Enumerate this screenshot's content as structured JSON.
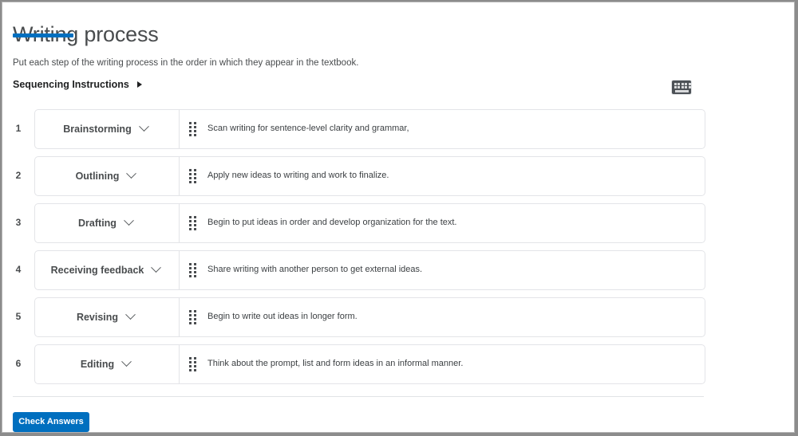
{
  "page": {
    "title": "Writing process",
    "accent_color": "#006fbf",
    "instructions": "Put each step of the writing process in the order in which they appear in the textbook.",
    "sequencing_instructions_label": "Sequencing Instructions",
    "sequencing_toggle_icon": "triangle-right-icon",
    "keyboard_icon": "keyboard-icon"
  },
  "sequence": {
    "items": [
      {
        "number": "1",
        "selected_step": "Brainstorming",
        "description": "Scan writing for sentence-level clarity and grammar,",
        "dropdown_icon": "chevron-down-icon",
        "drag_icon": "drag-handle-icon"
      },
      {
        "number": "2",
        "selected_step": "Outlining",
        "description": "Apply new ideas to writing and work to finalize.",
        "dropdown_icon": "chevron-down-icon",
        "drag_icon": "drag-handle-icon"
      },
      {
        "number": "3",
        "selected_step": "Drafting",
        "description": "Begin to put ideas in order and develop organization for the text.",
        "dropdown_icon": "chevron-down-icon",
        "drag_icon": "drag-handle-icon"
      },
      {
        "number": "4",
        "selected_step": "Receiving feedback",
        "description": "Share writing with another person to get external ideas.",
        "dropdown_icon": "chevron-down-icon",
        "drag_icon": "drag-handle-icon"
      },
      {
        "number": "5",
        "selected_step": "Revising",
        "description": "Begin to write out ideas in longer form.",
        "dropdown_icon": "chevron-down-icon",
        "drag_icon": "drag-handle-icon"
      },
      {
        "number": "6",
        "selected_step": "Editing",
        "description": "Think about the prompt, list and form ideas in an informal manner.",
        "dropdown_icon": "chevron-down-icon",
        "drag_icon": "drag-handle-icon"
      }
    ]
  },
  "footer": {
    "check_answers_label": "Check Answers"
  }
}
